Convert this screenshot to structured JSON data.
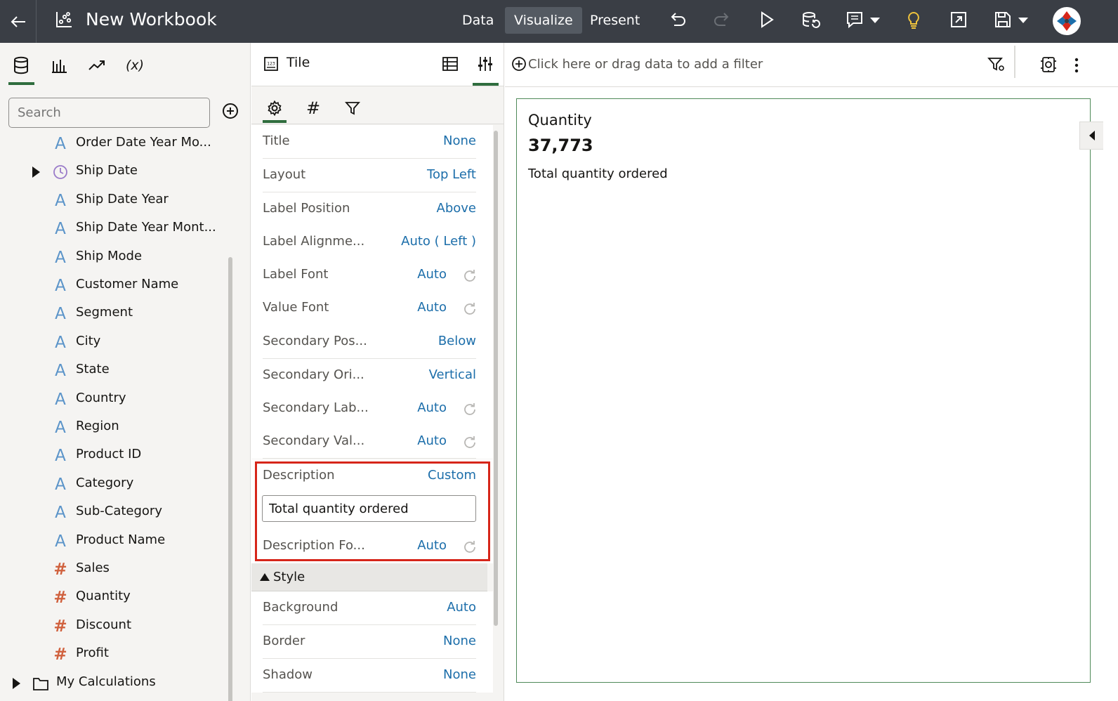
{
  "topbar": {
    "title": "New Workbook",
    "nav": [
      "Data",
      "Visualize",
      "Present"
    ],
    "active_nav": "Visualize",
    "icons": [
      "back-arrow-icon",
      "workbook-icon",
      "undo-icon",
      "redo-icon",
      "play-icon",
      "data-refresh-icon",
      "comment-icon",
      "lightbulb-icon",
      "export-icon",
      "save-icon",
      "avatar-icon"
    ]
  },
  "left_panel": {
    "tabs": [
      "data-icon",
      "visualizations-icon",
      "analytics-icon",
      "calculation-icon"
    ],
    "calc_tab_label": "(x)",
    "search_placeholder": "Search",
    "fields": [
      {
        "name": "Order Date Year Mo...",
        "type": "attribute"
      },
      {
        "name": "Ship Date",
        "type": "date",
        "expandable": true
      },
      {
        "name": "Ship Date Year",
        "type": "attribute"
      },
      {
        "name": "Ship Date Year Mont...",
        "type": "attribute"
      },
      {
        "name": "Ship Mode",
        "type": "attribute"
      },
      {
        "name": "Customer Name",
        "type": "attribute"
      },
      {
        "name": "Segment",
        "type": "attribute"
      },
      {
        "name": "City",
        "type": "attribute"
      },
      {
        "name": "State",
        "type": "attribute"
      },
      {
        "name": "Country",
        "type": "attribute"
      },
      {
        "name": "Region",
        "type": "attribute"
      },
      {
        "name": "Product ID",
        "type": "attribute"
      },
      {
        "name": "Category",
        "type": "attribute"
      },
      {
        "name": "Sub-Category",
        "type": "attribute"
      },
      {
        "name": "Product Name",
        "type": "attribute"
      },
      {
        "name": "Sales",
        "type": "measure"
      },
      {
        "name": "Quantity",
        "type": "measure"
      },
      {
        "name": "Discount",
        "type": "measure"
      },
      {
        "name": "Profit",
        "type": "measure"
      },
      {
        "name": "My Calculations",
        "type": "folder",
        "expandable": true
      }
    ],
    "attribute_glyph": "A",
    "measure_glyph": "#"
  },
  "properties": {
    "viz_type": "Tile",
    "tab_glyphs": {
      "number": "#"
    },
    "rows": [
      {
        "label": "Title",
        "value": "None"
      },
      {
        "label": "Layout",
        "value": "Top Left"
      },
      {
        "label": "Label Position",
        "value": "Above"
      },
      {
        "label": "Label Alignme...",
        "value": "Auto ( Left )"
      },
      {
        "label": "Label Font",
        "value": "Auto",
        "reset": true
      },
      {
        "label": "Value Font",
        "value": "Auto",
        "reset": true
      },
      {
        "label": "Secondary Pos...",
        "value": "Below"
      },
      {
        "label": "Secondary Ori...",
        "value": "Vertical"
      },
      {
        "label": "Secondary Lab...",
        "value": "Auto",
        "reset": true
      },
      {
        "label": "Secondary Val...",
        "value": "Auto",
        "reset": true
      }
    ],
    "description": {
      "label": "Description",
      "value": "Custom",
      "text": "Total quantity ordered"
    },
    "description_font": {
      "label": "Description Fo...",
      "value": "Auto"
    },
    "style_section": "Style",
    "style_rows": [
      {
        "label": "Background",
        "value": "Auto"
      },
      {
        "label": "Border",
        "value": "None"
      },
      {
        "label": "Shadow",
        "value": "None"
      }
    ]
  },
  "canvas": {
    "filter_placeholder": "Click here or drag data to add a filter",
    "tile": {
      "label": "Quantity",
      "value": "37,773",
      "description": "Total quantity ordered"
    }
  },
  "colors": {
    "topbar": "#3a3e45",
    "accent_green": "#2f6d3e",
    "link_blue": "#1c6eaa",
    "highlight_red": "#d6261a",
    "attribute_blue": "#5b94c9",
    "measure_orange": "#d0613e",
    "lightbulb_yellow": "#f0c43c"
  }
}
